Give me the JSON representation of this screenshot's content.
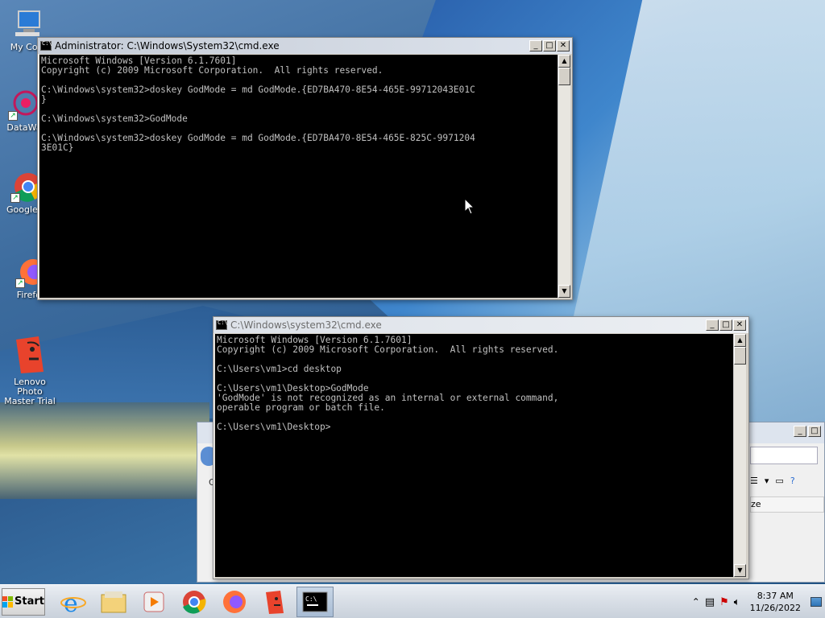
{
  "desktop": {
    "icons": [
      {
        "label": "My Com"
      },
      {
        "label": "DataWa"
      },
      {
        "label": "Google C"
      },
      {
        "label": "Firefox"
      },
      {
        "label": "Lenovo Photo Master Trial"
      }
    ]
  },
  "window_admin": {
    "title": "Administrator: C:\\Windows\\System32\\cmd.exe",
    "lines": "Microsoft Windows [Version 6.1.7601]\nCopyright (c) 2009 Microsoft Corporation.  All rights reserved.\n\nC:\\Windows\\system32>doskey GodMode = md GodMode.{ED7BA470-8E54-465E-99712043E01C\n}\n\nC:\\Windows\\system32>GodMode\n\nC:\\Windows\\system32>doskey GodMode = md GodMode.{ED7BA470-8E54-465E-825C-9971204\n3E01C}"
  },
  "window_user": {
    "title": "C:\\Windows\\system32\\cmd.exe",
    "lines": "Microsoft Windows [Version 6.1.7601]\nCopyright (c) 2009 Microsoft Corporation.  All rights reserved.\n\nC:\\Users\\vm1>cd desktop\n\nC:\\Users\\vm1\\Desktop>GodMode\n'GodMode' is not recognized as an internal or external command,\noperable program or batch file.\n\nC:\\Users\\vm1\\Desktop>"
  },
  "explorer": {
    "column_size": "ze",
    "partial_label": "O"
  },
  "window_buttons": {
    "minimize": "_",
    "maximize": "□",
    "close": "✕"
  },
  "taskbar": {
    "start_label": "Start",
    "clock_time": "8:37 AM",
    "clock_date": "11/26/2022"
  }
}
